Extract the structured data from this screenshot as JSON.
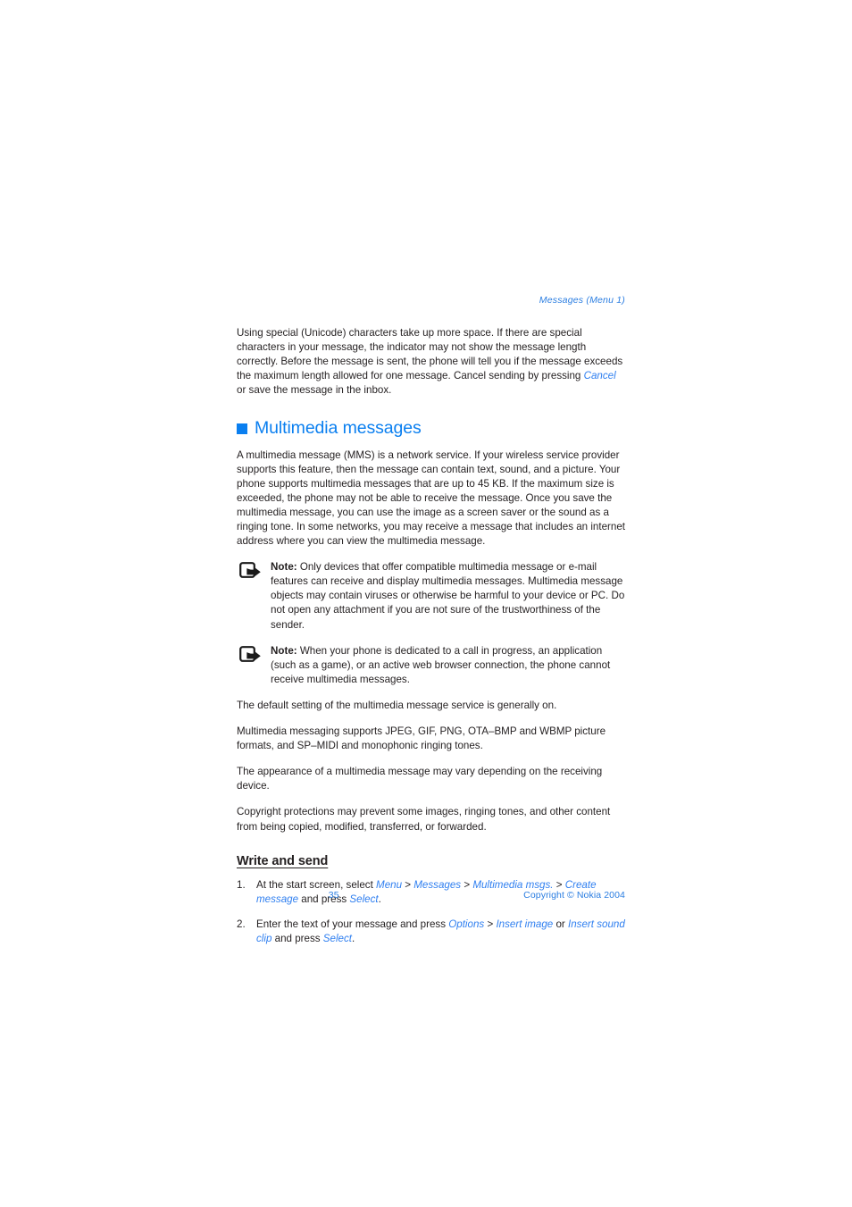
{
  "running_head": "Messages (Menu 1)",
  "intro_paragraph": "Using special (Unicode) characters take up more space. If there are special characters in your message, the indicator may not show the message length correctly. Before the message is sent, the phone will tell you if the message exceeds the maximum length allowed for one message. Cancel sending by pressing ",
  "intro_link": "Cancel",
  "intro_paragraph_tail": " or save the message in the inbox.",
  "section": {
    "title": "Multimedia messages",
    "bullet_color": "#0a7ff0",
    "intro": "A multimedia message (MMS) is a network service. If your wireless service provider supports this feature, then the message can contain text, sound, and a picture. Your phone supports multimedia messages that are up to 45 KB. If the maximum size is exceeded, the phone may not be able to receive the message. Once you save the multimedia message, you can use the image as a screen saver or the sound as a ringing tone. In some networks, you may receive a message that includes an internet address where you can view the multimedia message."
  },
  "notes": [
    {
      "icon": "note-pointer-icon",
      "label": "Note:",
      "text": " Only devices that offer compatible multimedia message or e-mail features can receive and display multimedia messages. Multimedia message objects may contain viruses or otherwise be harmful to your device or PC. Do not open any attachment if you are not sure of the trustworthiness of the sender."
    },
    {
      "icon": "note-pointer-icon",
      "label": "Note:",
      "text": " When your phone is dedicated to a call in progress, an application (such as a game), or an active web browser connection, the phone cannot receive multimedia messages."
    }
  ],
  "paragraphs": [
    "The default setting of the multimedia message service is generally on.",
    "Multimedia messaging supports JPEG, GIF, PNG, OTA–BMP and WBMP picture formats, and SP–MIDI and monophonic ringing tones.",
    "The appearance of a multimedia message may vary depending on the receiving device.",
    "Copyright protections may prevent some images, ringing tones, and other content from being copied, modified, transferred, or forwarded."
  ],
  "subsection": {
    "title": "Write and send",
    "steps": [
      {
        "number": "1.",
        "pre": "At the start screen, select ",
        "links": [
          "Menu",
          "Messages",
          "Multimedia msgs.",
          "Create message"
        ],
        "mid": " and press ",
        "final_link": "Select",
        "post": "."
      },
      {
        "number": "2.",
        "pre": "Enter the text of your message and press ",
        "links": [
          "Options",
          "Insert image",
          "Insert sound clip"
        ],
        "mid": " and press ",
        "final_link": "Select",
        "post": "."
      }
    ],
    "step1_sep1": " > ",
    "step1_sep2": " > ",
    "step1_sep3": " > ",
    "step2_sep1": " > ",
    "step2_sep2": " or "
  },
  "footer": {
    "page_number": "35",
    "copyright": "Copyright © Nokia 2004"
  },
  "colors": {
    "link_blue": "#2f7ff0",
    "heading_blue": "#0a7ff0",
    "footer_blue": "#2a7de1",
    "body_black": "#231f20"
  }
}
